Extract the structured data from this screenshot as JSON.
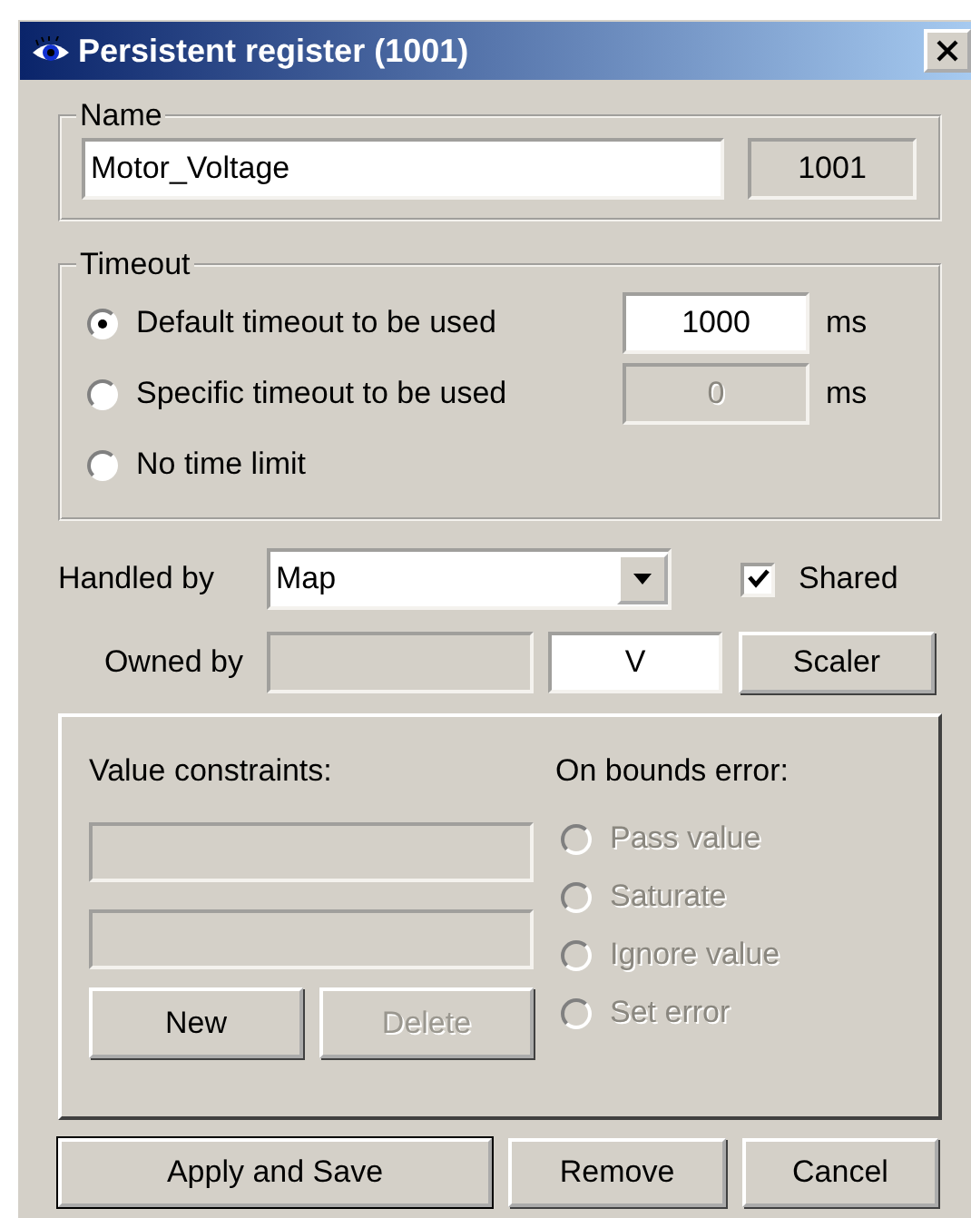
{
  "window": {
    "title": "Persistent register (1001)"
  },
  "name_group": {
    "legend": "Name",
    "name_value": "Motor_Voltage",
    "id_value": "1001"
  },
  "timeout_group": {
    "legend": "Timeout",
    "options": [
      {
        "label": "Default timeout to be used",
        "selected": true,
        "value": "1000",
        "unit": "ms",
        "disabled": false
      },
      {
        "label": "Specific timeout to be used",
        "selected": false,
        "value": "0",
        "unit": "ms",
        "disabled": true
      },
      {
        "label": "No time limit",
        "selected": false
      }
    ]
  },
  "handled_by": {
    "label": "Handled by",
    "value": "Map"
  },
  "shared": {
    "label": "Shared",
    "checked": true
  },
  "owned_by": {
    "label": "Owned by",
    "unit_value": "V",
    "button": "Scaler"
  },
  "constraints": {
    "label": "Value constraints:",
    "buttons": [
      {
        "label": "New",
        "disabled": false
      },
      {
        "label": "Delete",
        "disabled": true
      }
    ]
  },
  "bounds": {
    "label": "On bounds error:",
    "options": [
      {
        "label": "Pass value",
        "selected": false,
        "disabled": true
      },
      {
        "label": "Saturate",
        "selected": false,
        "disabled": true
      },
      {
        "label": "Ignore value",
        "selected": false,
        "disabled": true
      },
      {
        "label": "Set error",
        "selected": false,
        "disabled": true
      }
    ]
  },
  "footer_buttons": [
    {
      "label": "Apply and Save",
      "default": true
    },
    {
      "label": "Remove",
      "default": false
    },
    {
      "label": "Cancel",
      "default": false
    }
  ]
}
